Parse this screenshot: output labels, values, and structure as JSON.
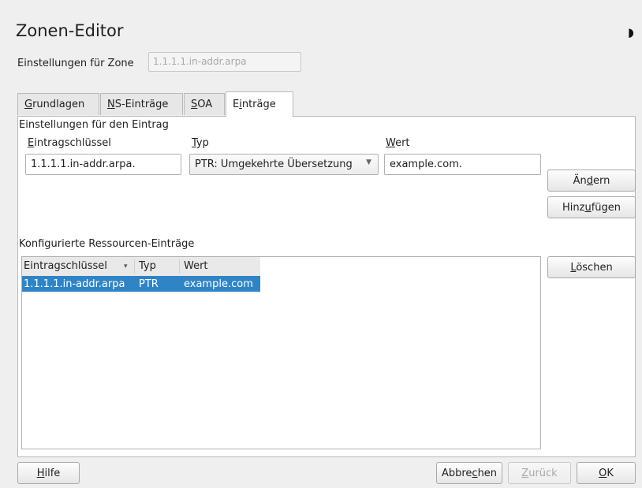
{
  "header": {
    "title": "Zonen-Editor",
    "theme_icon": "moon-icon",
    "zone_label": "Einstellungen für Zone",
    "zone_value": "1.1.1.1.in-addr.arpa"
  },
  "tabs": [
    {
      "label": "Grundlagen",
      "underline": "G",
      "rest": "rundlagen"
    },
    {
      "label": "NS-Einträge",
      "underline": "N",
      "rest": "S-Einträge"
    },
    {
      "label": "SOA",
      "underline": "S",
      "rest": "OA"
    },
    {
      "label": "Einträge",
      "pre": "E",
      "underline": "i",
      "rest": "nträge",
      "active": true
    }
  ],
  "entry": {
    "section_label": "Einstellungen für den Eintrag",
    "key_label_u": "E",
    "key_label_rest": "intragschlüssel",
    "type_label_u": "T",
    "type_label_rest": "yp",
    "value_label_u": "W",
    "value_label_rest": "ert",
    "key_value": "1.1.1.1.in-addr.arpa.",
    "type_value": "PTR: Umgekehrte Übersetzung",
    "value_value": "example.com."
  },
  "buttons": {
    "change_pre": "Än",
    "change_u": "d",
    "change_post": "ern",
    "add_pre": "Hinz",
    "add_u": "u",
    "add_post": "fügen",
    "delete_u": "L",
    "delete_post": "öschen",
    "help_u": "H",
    "help_post": "ilfe",
    "cancel_pre": "Abbre",
    "cancel_u": "c",
    "cancel_post": "hen",
    "back_u": "Z",
    "back_post": "urück",
    "ok_u": "O",
    "ok_post": "K"
  },
  "records": {
    "section_label": "Konfigurierte Ressourcen-Einträge",
    "columns": [
      "Eintragschlüssel",
      "Typ",
      "Wert"
    ],
    "sort_indicator": "▾",
    "rows": [
      {
        "key": "1.1.1.1.in-addr.arpa",
        "type": "PTR",
        "value": "example.com"
      }
    ]
  },
  "colors": {
    "selection": "#2f84c5",
    "window_bg": "#efefef"
  }
}
